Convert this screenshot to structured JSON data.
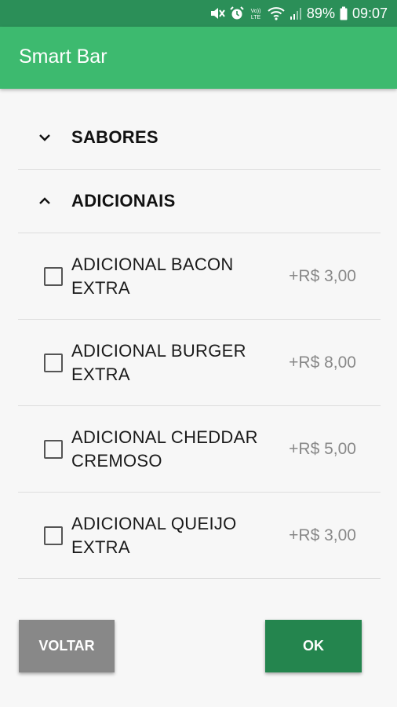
{
  "status_bar": {
    "battery_pct": "89%",
    "time": "09:07",
    "icons": [
      "mute-icon",
      "alarm-icon",
      "volte-icon",
      "wifi-icon",
      "signal-icon",
      "battery-icon"
    ],
    "volte_text": "Vo)) LTE"
  },
  "app_bar": {
    "title": "Smart Bar"
  },
  "sections": [
    {
      "label": "SABORES",
      "expanded": false
    },
    {
      "label": "ADICIONAIS",
      "expanded": true
    }
  ],
  "items": [
    {
      "name": "ADICIONAL BACON EXTRA",
      "price": "+R$ 3,00",
      "checked": false
    },
    {
      "name": "ADICIONAL BURGER EXTRA",
      "price": "+R$ 8,00",
      "checked": false
    },
    {
      "name": "ADICIONAL CHEDDAR CREMOSO",
      "price": "+R$ 5,00",
      "checked": false
    },
    {
      "name": "ADICIONAL QUEIJO EXTRA",
      "price": "+R$ 3,00",
      "checked": false
    }
  ],
  "buttons": {
    "back_label": "VOLTAR",
    "ok_label": "OK"
  },
  "colors": {
    "status_bar": "#2b8f58",
    "app_bar": "#3dba6f",
    "ok_button": "#24854e",
    "back_button": "#888888"
  }
}
